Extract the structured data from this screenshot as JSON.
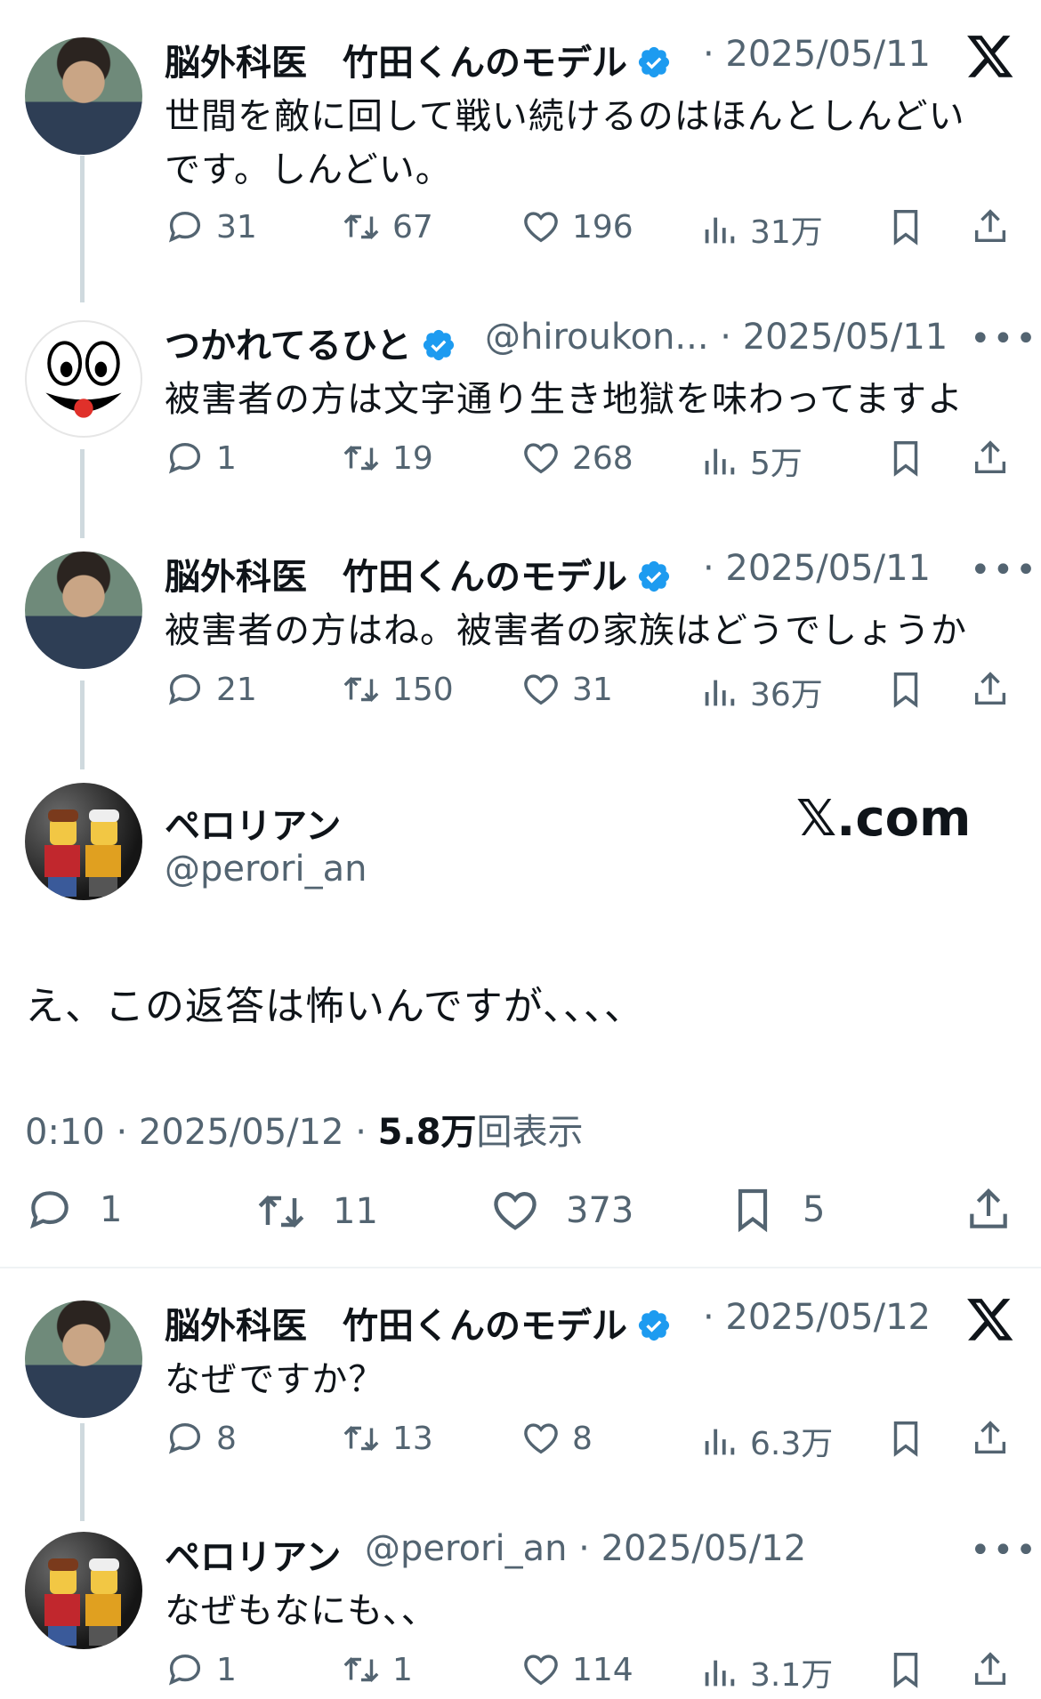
{
  "posts": [
    {
      "name": "脳外科医　竹田くんのモデル",
      "meta": "· 2025/05/11",
      "text": "世間を敵に回して戦い続けるのはほんとしんどい",
      "text2": "です。しんどい。",
      "replies": "31",
      "reposts": "67",
      "likes": "196",
      "views": "31万"
    },
    {
      "name": "つかれてるひと",
      "meta": "@hiroukon... · 2025/05/11",
      "text": "被害者の方は文字通り生き地獄を味わってますよ",
      "replies": "1",
      "reposts": "19",
      "likes": "268",
      "views": "5万"
    },
    {
      "name": "脳外科医　竹田くんのモデル",
      "meta": "· 2025/05/11",
      "text": "被害者の方はね。被害者の家族はどうでしょうか",
      "replies": "21",
      "reposts": "150",
      "likes": "31",
      "views": "36万"
    }
  ],
  "main": {
    "name": "ペロリアン",
    "handle": "@perori_an",
    "watermark": "𝕏.com",
    "text": "え、この返答は怖いんですが、、、、",
    "time": "0:10 · 2025/05/12 · ",
    "views_num": "5.8万",
    "views_label": "回表示",
    "replies": "1",
    "reposts": "11",
    "likes": "373",
    "bookmarks": "5"
  },
  "replies": [
    {
      "name": "脳外科医　竹田くんのモデル",
      "meta": "· 2025/05/12",
      "text": "なぜですか？",
      "replies": "8",
      "reposts": "13",
      "likes": "8",
      "views": "6.3万"
    },
    {
      "name": "ペロリアン",
      "meta": "@perori_an · 2025/05/12",
      "text": "なぜもなにも、、",
      "replies": "1",
      "reposts": "1",
      "likes": "114",
      "views": "3.1万"
    }
  ],
  "more_label": "•••"
}
